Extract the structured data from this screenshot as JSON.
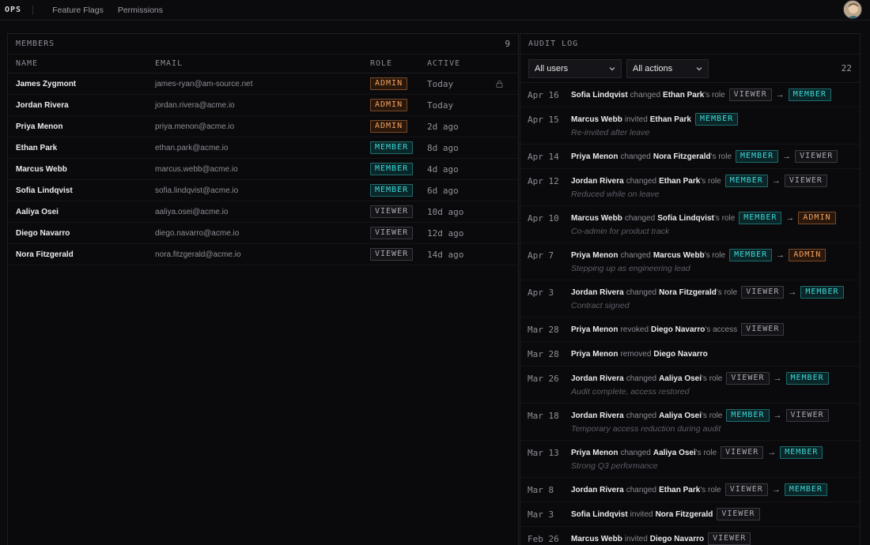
{
  "topbar": {
    "brand": "OPS",
    "nav": [
      "Feature Flags",
      "Permissions"
    ]
  },
  "members": {
    "title": "MEMBERS",
    "count": "9",
    "columns": {
      "name": "NAME",
      "email": "EMAIL",
      "role": "ROLE",
      "active": "ACTIVE"
    },
    "rows": [
      {
        "name": "James Zygmont",
        "email": "james-ryan@am-source.net",
        "role": "ADMIN",
        "active": "Today",
        "locked": true
      },
      {
        "name": "Jordan Rivera",
        "email": "jordan.rivera@acme.io",
        "role": "ADMIN",
        "active": "Today"
      },
      {
        "name": "Priya Menon",
        "email": "priya.menon@acme.io",
        "role": "ADMIN",
        "active": "2d ago"
      },
      {
        "name": "Ethan Park",
        "email": "ethan.park@acme.io",
        "role": "MEMBER",
        "active": "8d ago"
      },
      {
        "name": "Marcus Webb",
        "email": "marcus.webb@acme.io",
        "role": "MEMBER",
        "active": "4d ago"
      },
      {
        "name": "Sofia Lindqvist",
        "email": "sofia.lindqvist@acme.io",
        "role": "MEMBER",
        "active": "6d ago"
      },
      {
        "name": "Aaliya Osei",
        "email": "aaliya.osei@acme.io",
        "role": "VIEWER",
        "active": "10d ago"
      },
      {
        "name": "Diego Navarro",
        "email": "diego.navarro@acme.io",
        "role": "VIEWER",
        "active": "12d ago"
      },
      {
        "name": "Nora Fitzgerald",
        "email": "nora.fitzgerald@acme.io",
        "role": "VIEWER",
        "active": "14d ago"
      }
    ]
  },
  "audit": {
    "title": "AUDIT LOG",
    "filter_users": "All users",
    "filter_actions": "All actions",
    "count": "22",
    "entries": [
      {
        "date": "Apr 16",
        "actor": "Sofia Lindqvist",
        "verb": "changed",
        "target": "Ethan Park",
        "suffix": "'s role",
        "from": "VIEWER",
        "to": "MEMBER",
        "note": ""
      },
      {
        "date": "Apr 15",
        "actor": "Marcus Webb",
        "verb": "invited",
        "target": "Ethan Park",
        "suffix": "",
        "from": "",
        "to": "MEMBER",
        "note": "Re-invited after leave"
      },
      {
        "date": "Apr 14",
        "actor": "Priya Menon",
        "verb": "changed",
        "target": "Nora Fitzgerald",
        "suffix": "'s role",
        "from": "MEMBER",
        "to": "VIEWER",
        "note": ""
      },
      {
        "date": "Apr 12",
        "actor": "Jordan Rivera",
        "verb": "changed",
        "target": "Ethan Park",
        "suffix": "'s role",
        "from": "MEMBER",
        "to": "VIEWER",
        "note": "Reduced while on leave"
      },
      {
        "date": "Apr 10",
        "actor": "Marcus Webb",
        "verb": "changed",
        "target": "Sofia Lindqvist",
        "suffix": "'s role",
        "from": "MEMBER",
        "to": "ADMIN",
        "note": "Co-admin for product track"
      },
      {
        "date": "Apr 7",
        "actor": "Priya Menon",
        "verb": "changed",
        "target": "Marcus Webb",
        "suffix": "'s role",
        "from": "MEMBER",
        "to": "ADMIN",
        "note": "Stepping up as engineering lead"
      },
      {
        "date": "Apr 3",
        "actor": "Jordan Rivera",
        "verb": "changed",
        "target": "Nora Fitzgerald",
        "suffix": "'s role",
        "from": "VIEWER",
        "to": "MEMBER",
        "note": "Contract signed"
      },
      {
        "date": "Mar 28",
        "actor": "Priya Menon",
        "verb": "revoked",
        "target": "Diego Navarro",
        "suffix": "'s access",
        "from": "",
        "to": "VIEWER",
        "note": ""
      },
      {
        "date": "Mar 28",
        "actor": "Priya Menon",
        "verb": "removed",
        "target": "Diego Navarro",
        "suffix": "",
        "from": "",
        "to": "",
        "note": ""
      },
      {
        "date": "Mar 26",
        "actor": "Jordan Rivera",
        "verb": "changed",
        "target": "Aaliya Osei",
        "suffix": "'s role",
        "from": "VIEWER",
        "to": "MEMBER",
        "note": "Audit complete, access restored"
      },
      {
        "date": "Mar 18",
        "actor": "Jordan Rivera",
        "verb": "changed",
        "target": "Aaliya Osei",
        "suffix": "'s role",
        "from": "MEMBER",
        "to": "VIEWER",
        "note": "Temporary access reduction during audit"
      },
      {
        "date": "Mar 13",
        "actor": "Priya Menon",
        "verb": "changed",
        "target": "Aaliya Osei",
        "suffix": "'s role",
        "from": "VIEWER",
        "to": "MEMBER",
        "note": "Strong Q3 performance"
      },
      {
        "date": "Mar 8",
        "actor": "Jordan Rivera",
        "verb": "changed",
        "target": "Ethan Park",
        "suffix": "'s role",
        "from": "VIEWER",
        "to": "MEMBER",
        "note": ""
      },
      {
        "date": "Mar 3",
        "actor": "Sofia Lindqvist",
        "verb": "invited",
        "target": "Nora Fitzgerald",
        "suffix": "",
        "from": "",
        "to": "VIEWER",
        "note": ""
      },
      {
        "date": "Feb 26",
        "actor": "Marcus Webb",
        "verb": "invited",
        "target": "Diego Navarro",
        "suffix": "",
        "from": "",
        "to": "VIEWER",
        "note": ""
      }
    ]
  }
}
